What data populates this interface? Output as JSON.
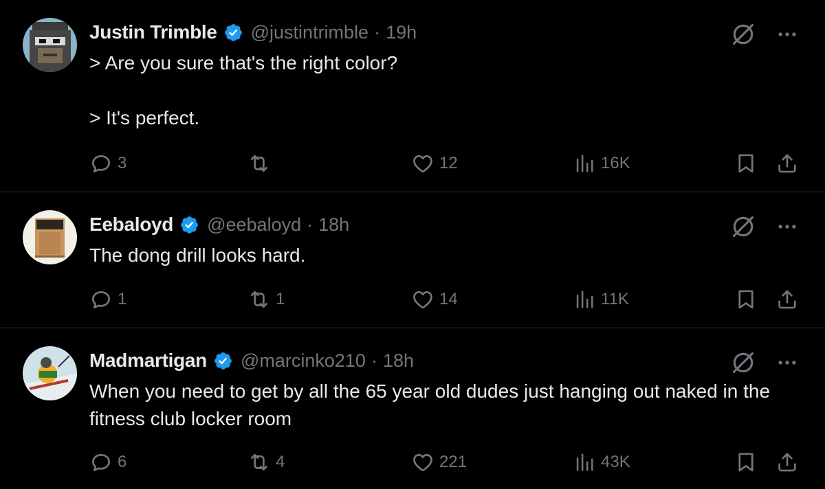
{
  "colors": {
    "background": "#000000",
    "primary_text": "#e7e9ea",
    "secondary_text": "#71767b",
    "verified_badge": "#1d9bf0",
    "divider": "#2f3336"
  },
  "tweets": [
    {
      "name": "Justin Trimble",
      "handle": "@justintrimble",
      "separator": "·",
      "time": "19h",
      "text": "> Are you sure that's the right color?\n\n> It's perfect.",
      "replies": "3",
      "retweets": "",
      "likes": "12",
      "views": "16K",
      "avatar_icon": "pixel-ape-avatar"
    },
    {
      "name": "Eebaloyd",
      "handle": "@eebaloyd",
      "separator": "·",
      "time": "18h",
      "text": "The dong drill looks hard.",
      "replies": "1",
      "retweets": "1",
      "likes": "14",
      "views": "11K",
      "avatar_icon": "wooden-speaker-avatar"
    },
    {
      "name": "Madmartigan",
      "handle": "@marcinko210",
      "separator": "·",
      "time": "18h",
      "text": "When you need to get by all the 65 year old dudes just hanging out naked in the fitness club locker room",
      "replies": "6",
      "retweets": "4",
      "likes": "221",
      "views": "43K",
      "avatar_icon": "cartoon-skier-avatar"
    }
  ]
}
